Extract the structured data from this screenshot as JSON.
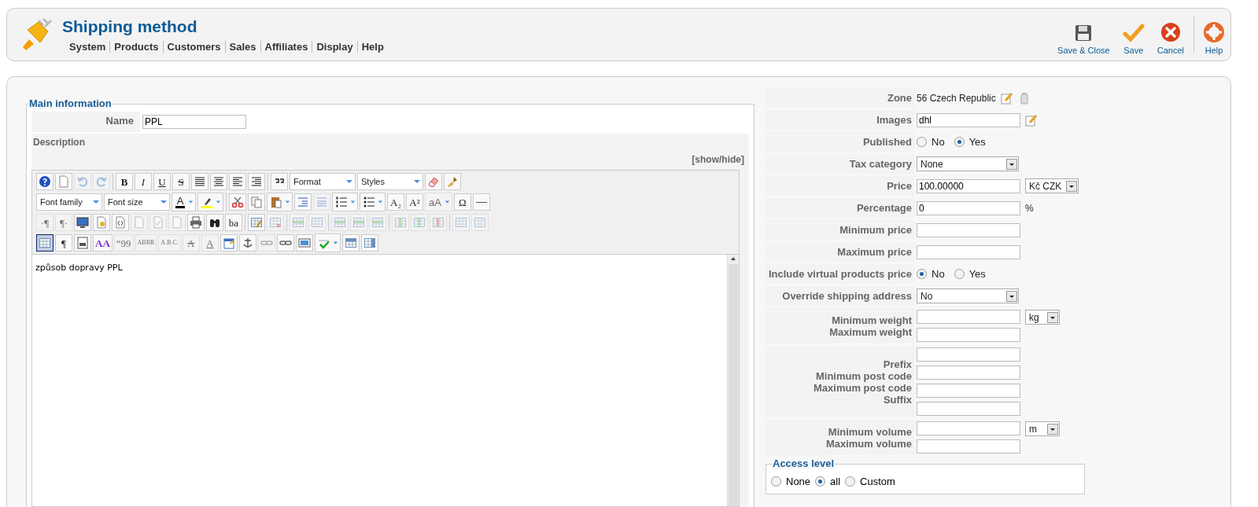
{
  "header": {
    "title": "Shipping method",
    "menu": [
      "System",
      "Products",
      "Customers",
      "Sales",
      "Affiliates",
      "Display",
      "Help"
    ],
    "toolbar": [
      {
        "kind": "save-close",
        "label": "Save & Close"
      },
      {
        "kind": "save",
        "label": "Save"
      },
      {
        "kind": "cancel",
        "label": "Cancel"
      },
      {
        "kind": "help",
        "label": "Help"
      }
    ]
  },
  "main": {
    "legend": "Main information",
    "name_label": "Name",
    "name_value": "PPL",
    "description_label": "Description",
    "show_hide": "[show/hide]",
    "editor_rows": [
      [
        [
          {
            "kind": "help",
            "disabled": false,
            "on": false
          },
          {
            "kind": "document",
            "disabled": false,
            "on": false
          },
          {
            "kind": "undo",
            "disabled": true,
            "on": false
          },
          {
            "kind": "redo",
            "disabled": true,
            "on": false
          }
        ],
        [
          {
            "kind": "bold",
            "text": "B",
            "disabled": false,
            "on": false
          },
          {
            "kind": "italic",
            "text": "I",
            "disabled": false,
            "on": false
          },
          {
            "kind": "underline",
            "text": "U",
            "disabled": false,
            "on": false
          },
          {
            "kind": "strike",
            "text": "S",
            "disabled": false,
            "on": false
          },
          {
            "kind": "align-full",
            "disabled": false,
            "on": false
          },
          {
            "kind": "align-center",
            "disabled": false,
            "on": false
          },
          {
            "kind": "align-left",
            "disabled": false,
            "on": false
          },
          {
            "kind": "align-right",
            "disabled": false,
            "on": false
          }
        ],
        [
          {
            "kind": "quote",
            "disabled": false,
            "on": false
          },
          {
            "kind": "select",
            "text": "Format",
            "disabled": false,
            "on": false
          },
          {
            "kind": "select",
            "text": "Styles",
            "disabled": false,
            "on": false
          },
          {
            "kind": "eraser",
            "disabled": false,
            "on": false
          },
          {
            "kind": "brush",
            "disabled": false,
            "on": false
          }
        ]
      ],
      [
        [
          {
            "kind": "select",
            "text": "Font family",
            "disabled": false,
            "on": false
          },
          {
            "kind": "select",
            "text": "Font size",
            "disabled": false,
            "on": false
          },
          {
            "kind": "forecolor",
            "text": "A",
            "disabled": false,
            "on": false
          },
          {
            "kind": "highlight",
            "disabled": false,
            "on": false
          }
        ],
        [
          {
            "kind": "cut",
            "disabled": false,
            "on": false
          },
          {
            "kind": "copy",
            "disabled": false,
            "on": false
          },
          {
            "kind": "paste",
            "split": true,
            "disabled": false,
            "on": false
          },
          {
            "kind": "indent",
            "disabled": false,
            "on": false
          },
          {
            "kind": "outdent",
            "disabled": true,
            "on": false
          },
          {
            "kind": "numlist",
            "split": true,
            "disabled": false,
            "on": false
          },
          {
            "kind": "bullist",
            "split": true,
            "disabled": false,
            "on": false
          },
          {
            "kind": "glyph",
            "text": "A₂",
            "disabled": false,
            "on": false
          },
          {
            "kind": "glyph",
            "text": "A²",
            "disabled": false,
            "on": false
          },
          {
            "kind": "glyph",
            "text": "aA",
            "split": true,
            "disabled": true,
            "on": false
          },
          {
            "kind": "glyph",
            "text": "Ω",
            "disabled": false,
            "on": false
          },
          {
            "kind": "rule",
            "disabled": false,
            "on": false
          }
        ]
      ],
      [
        [
          {
            "kind": "glyph",
            "text": "·¶",
            "disabled": true,
            "on": false
          },
          {
            "kind": "glyph",
            "text": "¶·",
            "disabled": true,
            "on": false
          },
          {
            "kind": "monitor",
            "disabled": false,
            "on": false
          },
          {
            "kind": "preview",
            "disabled": false,
            "on": false
          },
          {
            "kind": "code",
            "disabled": false,
            "on": false
          },
          {
            "kind": "document",
            "disabled": true,
            "on": false
          },
          {
            "kind": "document-check",
            "disabled": true,
            "on": false
          },
          {
            "kind": "document",
            "disabled": true,
            "on": false
          },
          {
            "kind": "print",
            "disabled": false,
            "on": false
          },
          {
            "kind": "binoculars",
            "disabled": false,
            "on": false
          },
          {
            "kind": "glyph",
            "text": "ba",
            "disabled": false,
            "on": false
          }
        ],
        [
          {
            "kind": "table",
            "disabled": false,
            "on": false
          },
          {
            "kind": "table-delete",
            "disabled": true,
            "on": false
          }
        ],
        [
          {
            "kind": "row",
            "disabled": true,
            "on": false
          },
          {
            "kind": "cell",
            "disabled": true,
            "on": false
          }
        ],
        [
          {
            "kind": "row-before",
            "disabled": true,
            "on": false
          },
          {
            "kind": "row-after",
            "disabled": true,
            "on": false
          },
          {
            "kind": "row-delete",
            "disabled": true,
            "on": false
          }
        ],
        [
          {
            "kind": "col-before",
            "disabled": true,
            "on": false
          },
          {
            "kind": "col-after",
            "disabled": true,
            "on": false
          },
          {
            "kind": "col-delete",
            "disabled": true,
            "on": false
          }
        ],
        [
          {
            "kind": "grid",
            "disabled": true,
            "on": false
          },
          {
            "kind": "cell",
            "disabled": true,
            "on": false
          }
        ]
      ],
      [
        [
          {
            "kind": "grid",
            "disabled": false,
            "on": true
          },
          {
            "kind": "glyph",
            "text": "¶",
            "disabled": false,
            "on": false
          },
          {
            "kind": "pagebreak",
            "disabled": false,
            "on": false
          },
          {
            "kind": "styleprops",
            "text": "AA",
            "disabled": false,
            "on": false
          },
          {
            "kind": "glyph",
            "text": "“99",
            "disabled": true,
            "on": false
          },
          {
            "kind": "glyph",
            "text": "ABBR",
            "disabled": true,
            "on": false
          },
          {
            "kind": "glyph",
            "text": "A.B.C.",
            "disabled": true,
            "on": false
          },
          {
            "kind": "strike",
            "text": "A",
            "disabled": true,
            "on": false
          },
          {
            "kind": "underline",
            "text": "A",
            "disabled": true,
            "on": false
          },
          {
            "kind": "attributes",
            "disabled": false,
            "on": false
          },
          {
            "kind": "anchor",
            "disabled": false,
            "on": false
          },
          {
            "kind": "unlink",
            "disabled": true,
            "on": false
          },
          {
            "kind": "link",
            "disabled": false,
            "on": false
          },
          {
            "kind": "image",
            "disabled": false,
            "on": false
          },
          {
            "kind": "spellcheck",
            "split": true,
            "disabled": false,
            "on": false
          },
          {
            "kind": "layer",
            "disabled": false,
            "on": false
          },
          {
            "kind": "template",
            "disabled": false,
            "on": false
          }
        ]
      ]
    ],
    "editor_text": "způsob dopravy PPL"
  },
  "form": {
    "rows": [
      {
        "kind": "text",
        "labels": [
          "Zone"
        ],
        "value": "56 Czech Republic",
        "editable": true,
        "deletable": true
      },
      {
        "kind": "input",
        "labels": [
          "Images"
        ],
        "value": "dhl",
        "editable": true,
        "deletable": false
      },
      {
        "kind": "radio",
        "labels": [
          "Published"
        ],
        "options": [
          {
            "label": "No",
            "selected": false
          },
          {
            "label": "Yes",
            "selected": true
          }
        ]
      },
      {
        "kind": "select",
        "labels": [
          "Tax category"
        ],
        "value": "None"
      },
      {
        "kind": "input",
        "labels": [
          "Price"
        ],
        "value": "100.00000",
        "unit_select": "Kč CZK"
      },
      {
        "kind": "input",
        "labels": [
          "Percentage"
        ],
        "value": "0",
        "suffix": "%"
      },
      {
        "kind": "input",
        "labels": [
          "Minimum price"
        ]
      },
      {
        "kind": "input",
        "labels": [
          "Maximum price"
        ]
      },
      {
        "kind": "radio",
        "labels": [
          "Include virtual products price"
        ],
        "options": [
          {
            "label": "No",
            "selected": true
          },
          {
            "label": "Yes",
            "selected": false
          }
        ]
      },
      {
        "kind": "select",
        "labels": [
          "Override shipping address"
        ],
        "value": "No"
      },
      {
        "kind": "inputs",
        "labels": [
          "Minimum weight",
          "Maximum weight"
        ],
        "unit_select": "kg"
      },
      {
        "kind": "inputs",
        "labels": [
          "Prefix",
          "Minimum post code",
          "Maximum post code",
          "Suffix"
        ]
      },
      {
        "kind": "inputs",
        "labels": [
          "Minimum volume",
          "Maximum volume"
        ],
        "unit_select": "m"
      }
    ],
    "access": {
      "legend": "Access level",
      "options": [
        {
          "label": "None",
          "selected": false
        },
        {
          "label": "all",
          "selected": true
        },
        {
          "label": "Custom",
          "selected": false
        }
      ]
    }
  }
}
